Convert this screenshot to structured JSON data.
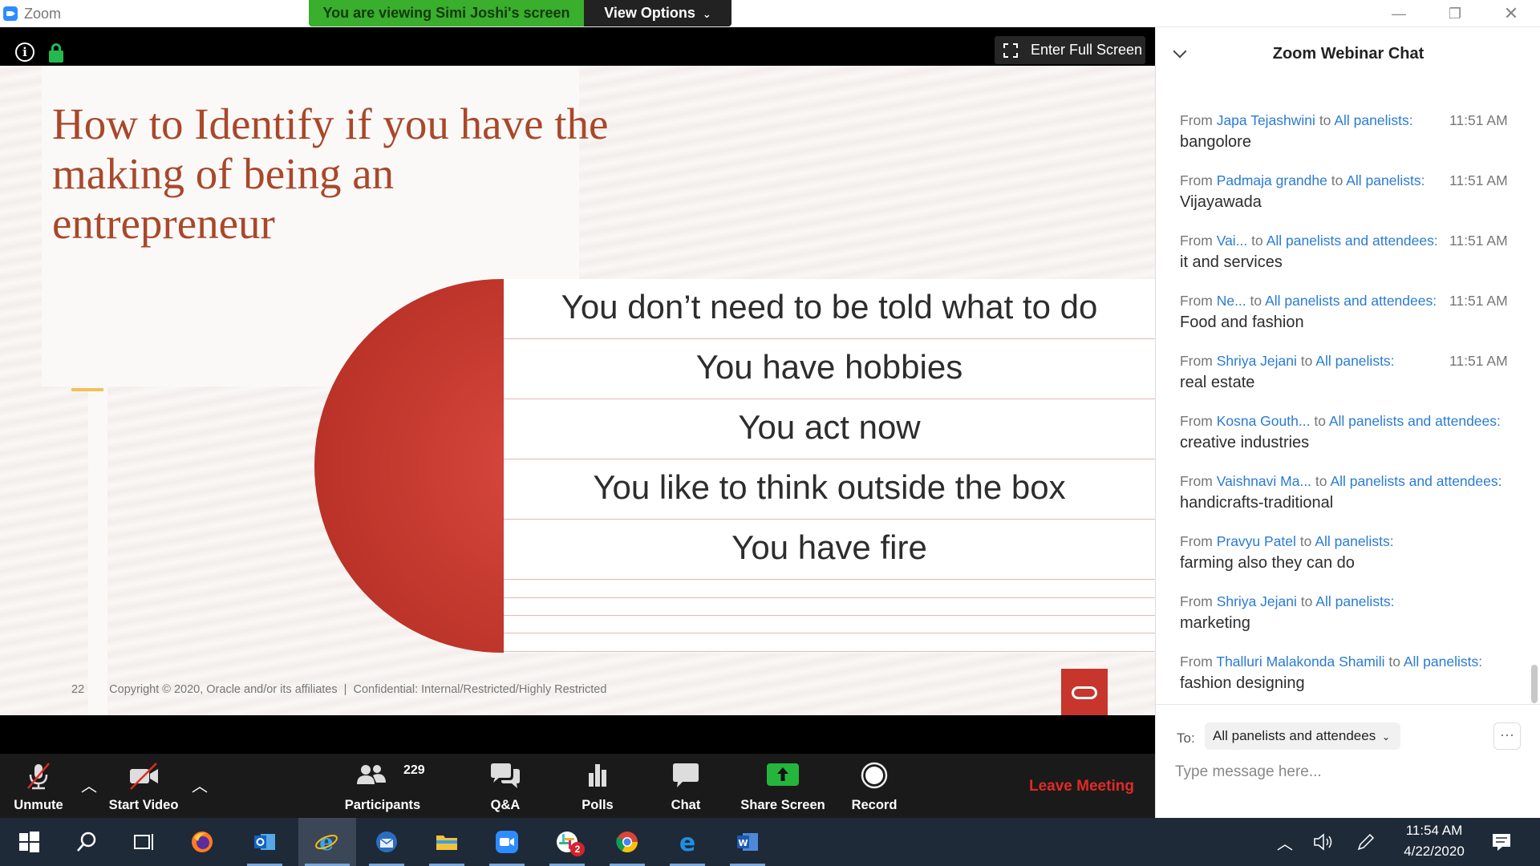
{
  "window": {
    "app_title": "Zoom",
    "viewing_banner": "You are viewing Simi Joshi's screen",
    "view_options": "View Options",
    "controls": [
      "—",
      "❐",
      "✕"
    ]
  },
  "video": {
    "fullscreen_label": "Enter Full Screen"
  },
  "slide": {
    "title": "How to Identify if you have the making of being an entrepreneur",
    "items": [
      "You don’t need to be told what to do",
      "You have hobbies",
      "You act now",
      "You like to think outside the box",
      "You have fire"
    ],
    "page_number": "22",
    "footer": "Copyright © 2020, Oracle and/or its affiliates  |  Confidential: Internal/Restricted/Highly Restricted",
    "accent_color": "#a9482a",
    "circle_color": "#c63b30"
  },
  "toolbar": {
    "unmute": "Unmute",
    "start_video": "Start Video",
    "participants": "Participants",
    "participant_count": "229",
    "qa": "Q&A",
    "polls": "Polls",
    "chat": "Chat",
    "share_screen": "Share Screen",
    "record": "Record",
    "leave": "Leave Meeting"
  },
  "chat": {
    "title": "Zoom Webinar Chat",
    "messages": [
      {
        "from": "From",
        "name": "Japa Tejashwini",
        "to_word": "to",
        "to": "All panelists:",
        "time": "11:51 AM",
        "text": "bangolore"
      },
      {
        "from": "From",
        "name": "Padmaja grandhe",
        "to_word": "to",
        "to": "All panelists:",
        "time": "11:51 AM",
        "text": "Vijayawada"
      },
      {
        "from": "From",
        "name": "Vai...",
        "to_word": "to",
        "to": "All panelists and attendees:",
        "time": "11:51 AM",
        "text": "it and services"
      },
      {
        "from": "From",
        "name": "Ne...",
        "to_word": "to",
        "to": "All panelists and attendees:",
        "time": "11:51 AM",
        "text": "Food and fashion"
      },
      {
        "from": "From",
        "name": "Shriya Jejani",
        "to_word": "to",
        "to": "All panelists:",
        "time": "11:51 AM",
        "text": "real estate"
      },
      {
        "from": "From",
        "name": "Kosna Gouth...",
        "to_word": "to",
        "to": "All panelists and attendees:",
        "time": "",
        "text": "creative industries"
      },
      {
        "from": "From",
        "name": "Vaishnavi Ma...",
        "to_word": "to",
        "to": "All panelists and attendees:",
        "time": "",
        "text": "handicrafts-traditional"
      },
      {
        "from": "From",
        "name": "Pravyu Patel",
        "to_word": "to",
        "to": "All panelists:",
        "time": "",
        "text": "farming also they can do"
      },
      {
        "from": "From",
        "name": "Shriya Jejani",
        "to_word": "to",
        "to": "All panelists:",
        "time": "",
        "text": "marketing"
      },
      {
        "from": "From",
        "name": "Thalluri Malakonda Shamili",
        "to_word": "to",
        "to": "All panelists:",
        "time": "",
        "text": "fashion designing"
      }
    ],
    "to_label": "To:",
    "recipient": "All panelists and attendees",
    "more": "···",
    "input_placeholder": "Type message here..."
  },
  "taskbar": {
    "apps": [
      "windows-start",
      "search",
      "task-view",
      "firefox",
      "outlook",
      "internet-explorer",
      "thunderbird",
      "file-explorer",
      "zoom",
      "slack",
      "chrome",
      "edge",
      "word"
    ],
    "slack_badge": "2",
    "time": "11:54 AM",
    "date": "4/22/2020"
  }
}
